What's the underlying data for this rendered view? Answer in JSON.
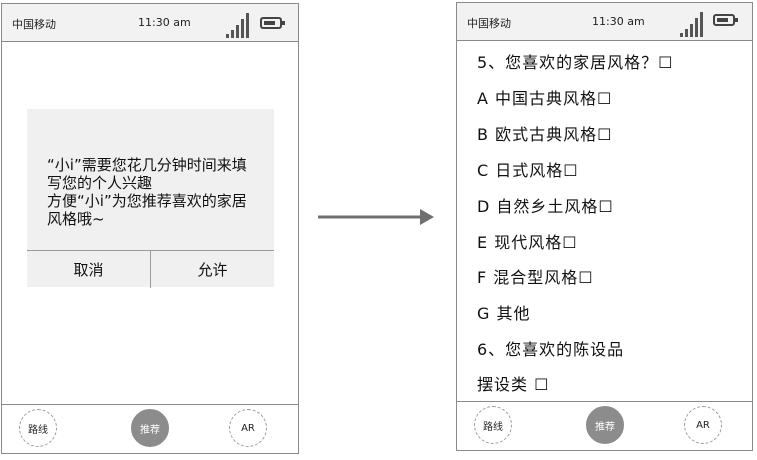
{
  "left_phone": {
    "status": {
      "carrier": "中国移动",
      "time": "11:30 am"
    },
    "dialog": {
      "lines": [
        "“小i”需要您花几分钟时间来填",
        "写您的个人兴趣",
        "方便“小i”为您推荐喜欢的家居",
        "风格哦~"
      ],
      "cancel_label": "取消",
      "allow_label": "允许"
    },
    "tabs": [
      {
        "label": "路线"
      },
      {
        "label": "推荐"
      },
      {
        "label": "AR"
      }
    ]
  },
  "right_phone": {
    "status": {
      "carrier": "中国移动",
      "time": "11:30 am"
    },
    "items": [
      "5、您喜欢的家居风格？☐",
      "A 中国古典风格☐",
      "B 欧式古典风格☐",
      "C 日式风格☐",
      "D 自然乡土风格☐",
      "E 现代风格☐",
      "F 混合型风格☐",
      "G 其他",
      "6、您喜欢的陈设品",
      "摆设类 ☐"
    ],
    "tabs": [
      {
        "label": "路线"
      },
      {
        "label": "推荐"
      },
      {
        "label": "AR"
      }
    ]
  },
  "colors": {
    "active_tab": "#8c8c8c",
    "dialog_bg": "#f0f0f0",
    "status_bg": "#f2f2f2"
  },
  "icons": [
    "signal-icon",
    "battery-icon",
    "right-arrow-icon"
  ]
}
